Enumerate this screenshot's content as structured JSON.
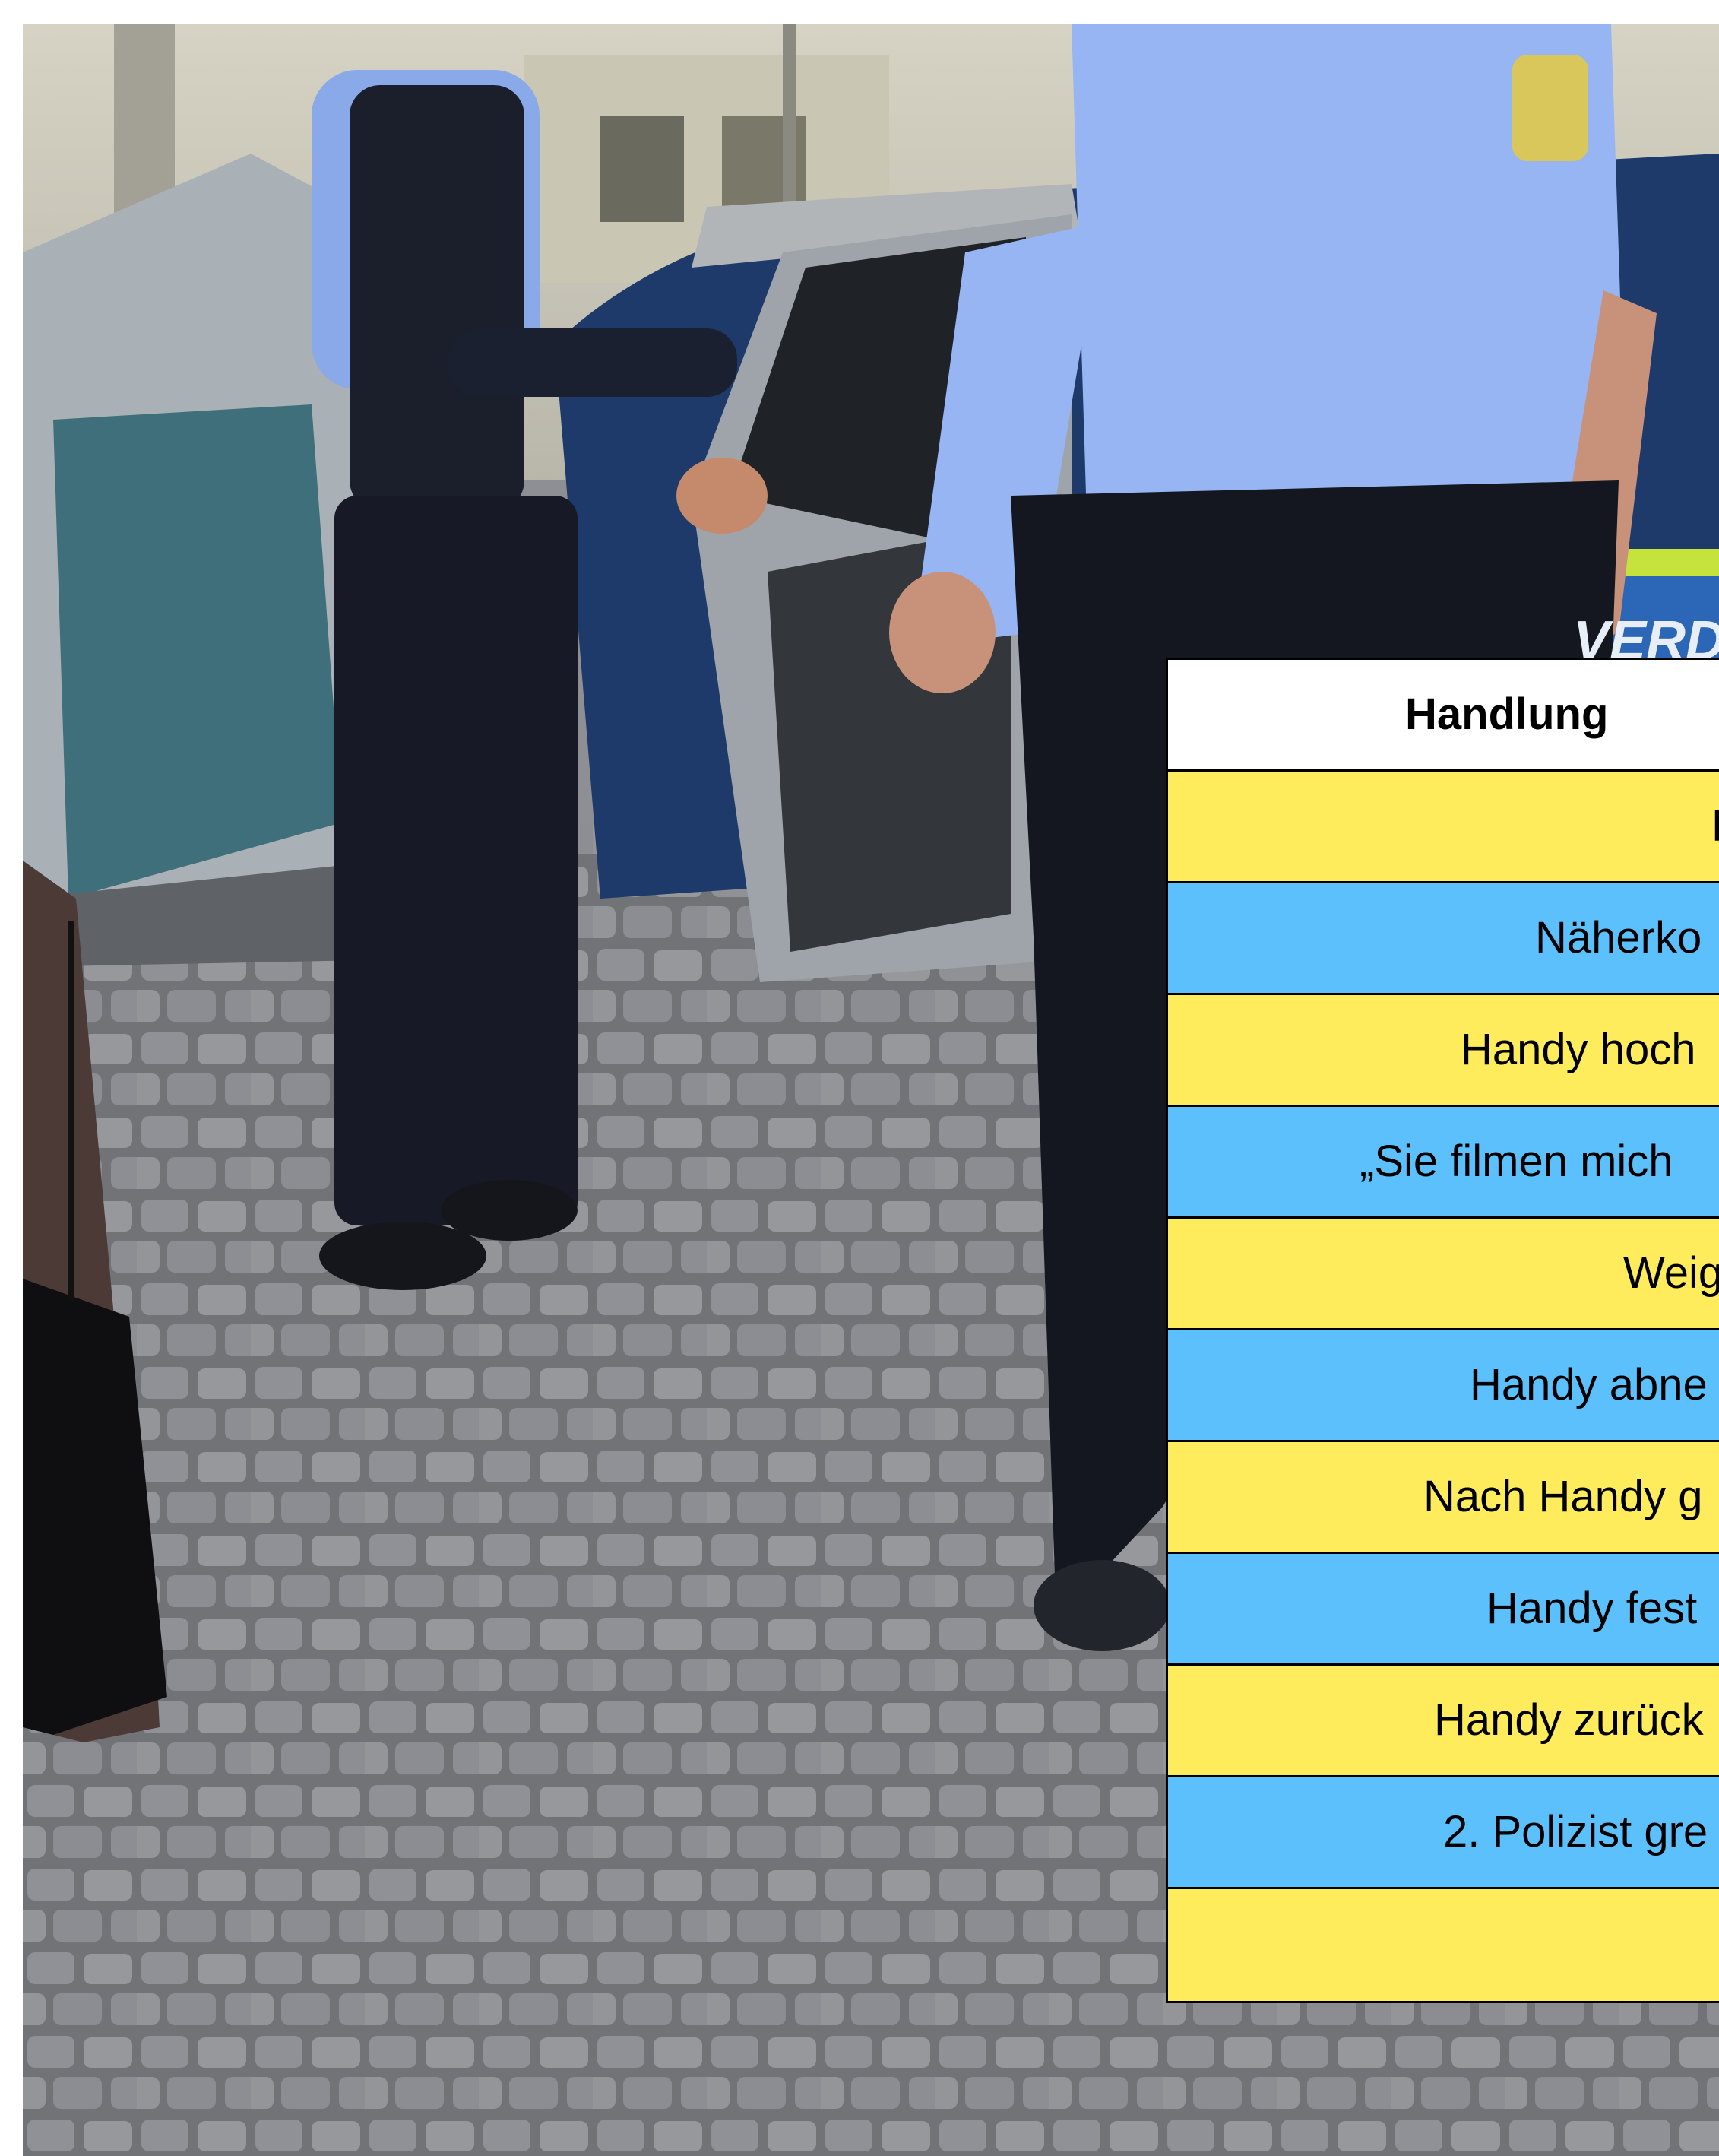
{
  "photo": {
    "vehicle_lettering": "VERDA"
  },
  "table": {
    "header": "Handlung",
    "rows": [
      {
        "text": "F",
        "color": "yellow"
      },
      {
        "text": "Näherko",
        "color": "blue"
      },
      {
        "text": "Handy hoch",
        "color": "yellow"
      },
      {
        "text": "„Sie filmen mich",
        "color": "blue"
      },
      {
        "text": "Weig",
        "color": "yellow"
      },
      {
        "text": "Handy abne",
        "color": "blue"
      },
      {
        "text": "Nach Handy g",
        "color": "yellow"
      },
      {
        "text": "Handy fest",
        "color": "blue"
      },
      {
        "text": "Handy zurück",
        "color": "yellow"
      },
      {
        "text": "2. Polizist gre",
        "color": "blue"
      },
      {
        "text": "",
        "color": "yellow"
      }
    ]
  },
  "colors": {
    "yellow_row": "#ffec5c",
    "blue_row": "#5bc0fb"
  }
}
